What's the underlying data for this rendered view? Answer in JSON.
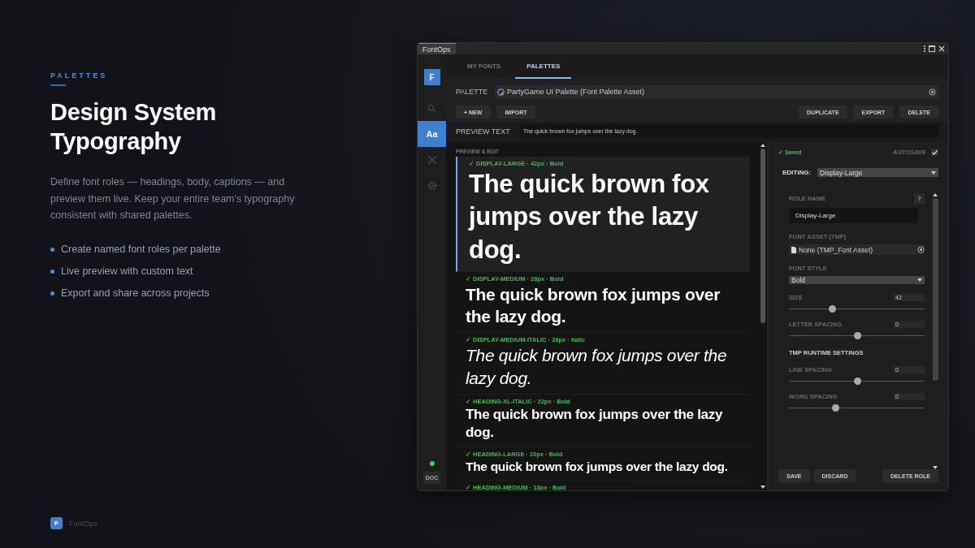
{
  "hero": {
    "eyebrow": "PALETTES",
    "title": "Design System Typography",
    "description": "Define font roles — headings, body, captions — and preview them live. Keep your entire team's typography consistent with shared palettes.",
    "bullets": [
      "Create named font roles per palette",
      "Live preview with custom text",
      "Export and share across projects"
    ]
  },
  "footer": {
    "logo": "F",
    "name": "FontOps"
  },
  "window": {
    "tab": "FontOps",
    "sidebar": {
      "logo": "F",
      "items": [
        {
          "kind": "search",
          "selected": false
        },
        {
          "kind": "text",
          "label": "Aa",
          "selected": true
        },
        {
          "kind": "tools",
          "selected": false
        },
        {
          "kind": "settings",
          "selected": false
        }
      ],
      "doc": "DOC"
    },
    "tabs": [
      {
        "label": "MY FONTS",
        "selected": false
      },
      {
        "label": "PALETTES",
        "selected": true
      }
    ],
    "palette": {
      "label": "PALETTE",
      "value": "PartyGame UI Palette (Font Palette Asset)"
    },
    "actions_left": [
      "+ NEW",
      "IMPORT"
    ],
    "actions_right": [
      "DUPLICATE",
      "EXPORT",
      "DELETE"
    ],
    "preview_text": {
      "label": "PREVIEW TEXT",
      "value": "The quick brown fox jumps over the lazy dog."
    },
    "preview": {
      "heading": "PREVIEW & EDIT",
      "items": [
        {
          "kind": "display-large",
          "meta": "✓ DISPLAY-LARGE · 42px · Bold",
          "sample": "The quick brown fox jumps over the lazy dog.",
          "selected": true
        },
        {
          "kind": "display-medium",
          "meta": "✓ DISPLAY-MEDIUM · 28px · Bold",
          "sample": "The quick brown fox jumps over the lazy dog.",
          "selected": false
        },
        {
          "kind": "display-medium-italic",
          "meta": "✓ DISPLAY-MEDIUM-ITALIC · 28px · Italic",
          "sample": "The quick brown fox jumps over the lazy dog.",
          "selected": false
        },
        {
          "kind": "heading-xl",
          "meta": "✓ HEADING-XL-ITALIC · 22px · Bold",
          "sample": "The quick brown fox jumps over the lazy dog.",
          "selected": false
        },
        {
          "kind": "heading-large",
          "meta": "✓ HEADING-LARGE · 20px · Bold",
          "sample": "The quick brown fox jumps over the lazy dog.",
          "selected": false
        },
        {
          "meta": "✓ HEADING-MEDIUM · 18px · Bold",
          "selected": false
        }
      ]
    },
    "editor": {
      "status": "✓ Saved",
      "autosave": {
        "label": "AUTOSAVE",
        "checked": true
      },
      "editing": {
        "label": "EDITING:",
        "value": "Display-Large"
      },
      "fields": [
        {
          "kind": "text",
          "label": "ROLE NAME",
          "value": "Display-Large",
          "help": "?"
        },
        {
          "kind": "asset",
          "label": "FONT ASSET (TMP)",
          "value": "None (TMP_Font Asset)"
        },
        {
          "kind": "select",
          "label": "FONT STYLE",
          "value": "Bold"
        },
        {
          "kind": "slider",
          "label": "SIZE",
          "value": "42",
          "level": 0.32
        },
        {
          "kind": "slider",
          "label": "LETTER SPACING",
          "value": "0",
          "level": 0.5
        },
        {
          "kind": "section",
          "label": "TMP RUNTIME SETTINGS"
        },
        {
          "kind": "slider",
          "label": "LINE SPACING",
          "value": "0",
          "level": 0.5
        },
        {
          "kind": "slider",
          "label": "WORD SPACING",
          "value": "0",
          "level": 0.34
        }
      ],
      "buttons_left": [
        "SAVE",
        "DISCARD"
      ],
      "button_right": "DELETE ROLE"
    }
  }
}
